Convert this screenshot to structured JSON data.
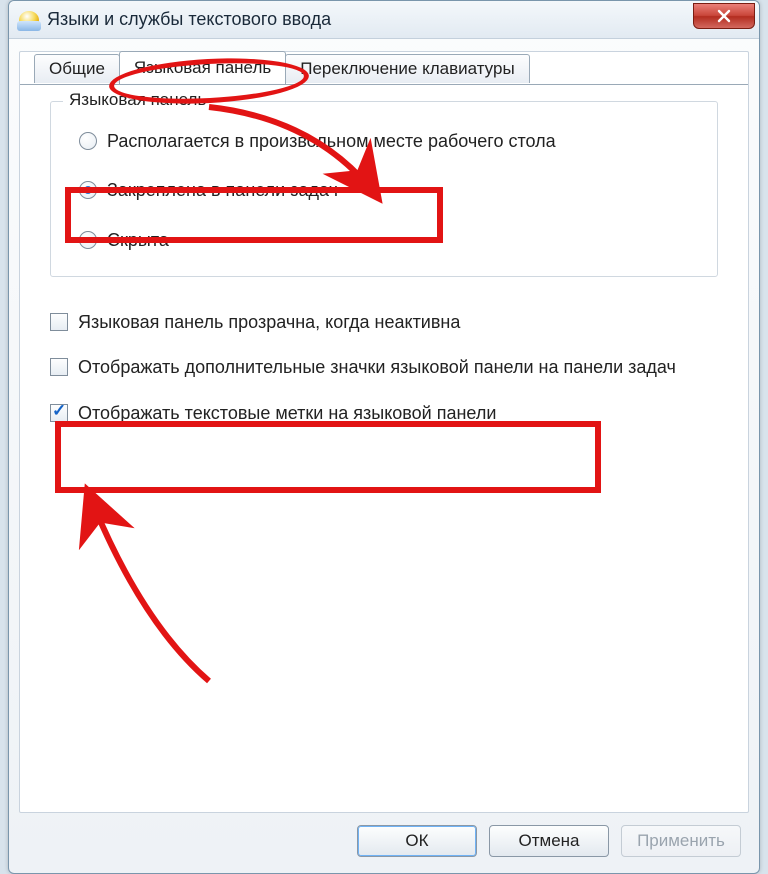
{
  "window": {
    "title": "Языки и службы текстового ввода"
  },
  "tabs": [
    {
      "label": "Общие"
    },
    {
      "label": "Языковая панель"
    },
    {
      "label": "Переключение клавиатуры"
    }
  ],
  "groupbox": {
    "legend": "Языковая панель",
    "radios": [
      {
        "label": "Располагается в произвольном месте рабочего стола",
        "checked": false
      },
      {
        "label": "Закреплена в панели задач",
        "checked": true
      },
      {
        "label": "Скрыта",
        "checked": false
      }
    ]
  },
  "checkboxes": [
    {
      "label": "Языковая панель прозрачна, когда неактивна",
      "checked": false
    },
    {
      "label": "Отображать дополнительные значки языковой панели на панели задач",
      "checked": false
    },
    {
      "label": "Отображать текстовые метки на языковой панели",
      "checked": true
    }
  ],
  "buttons": {
    "ok": "ОК",
    "cancel": "Отмена",
    "apply": "Применить"
  }
}
